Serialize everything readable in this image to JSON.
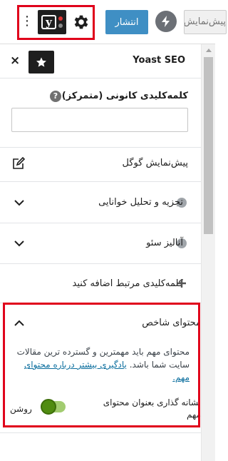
{
  "toolbar": {
    "publish_label": "انتشار",
    "preview_label": "پیش‌نمایش",
    "more_icon": "kebab-menu-icon",
    "yoast_icon": "yoast-logo-icon",
    "settings_icon": "gear-icon",
    "jetpack_icon": "bolt-icon",
    "yoast_letter": "y"
  },
  "sidebar": {
    "title": "Yoast SEO",
    "close_symbol": "×",
    "pin_icon": "star-icon"
  },
  "focus_keyphrase": {
    "label": "کلمه‌کلیدی کانونی (متمرکز)",
    "help_symbol": "?",
    "value": "",
    "placeholder": ""
  },
  "panels": [
    {
      "label": "پیش‌نمایش گوگل",
      "icon": "edit-icon"
    },
    {
      "label": "تجزیه و تحلیل خوانایی",
      "icon": "chevron-down-icon"
    },
    {
      "label": "آنالیز سئو",
      "icon": "chevron-down-icon"
    },
    {
      "label": "کلمه‌کلیدی مرتبط اضافه کنید",
      "icon": "plus-icon"
    }
  ],
  "cornerstone": {
    "title": "محتوای شاخص",
    "description": "محتوای مهم باید مهمترین و گسترده ترین مقالات سایت شما باشد.",
    "link_text": "یادگیری بیشتر درباره محتوای مهم.",
    "toggle_label": "نشانه گذاری بعنوان محتوای مهم",
    "toggle_state": "روشن",
    "toggle_on": true
  },
  "colors": {
    "highlight_red": "#e0001b",
    "publish_blue": "#3f8fc4",
    "link_blue": "#0b6e9e",
    "toggle_green": "#508c11",
    "bullet_gray": "#a0a5aa"
  }
}
